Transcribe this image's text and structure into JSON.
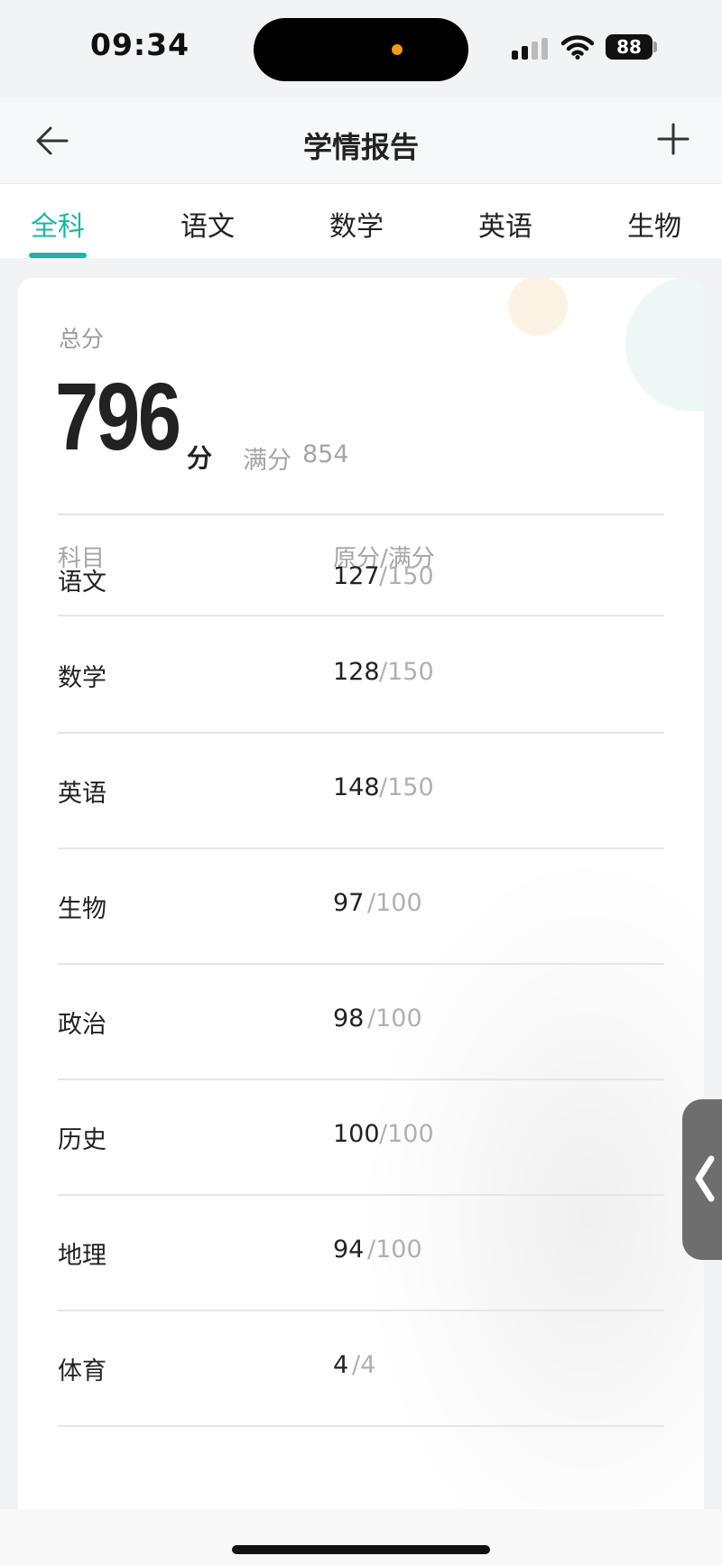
{
  "status_bar": {
    "time": "09:34",
    "battery": "88"
  },
  "nav": {
    "title": "学情报告"
  },
  "tabs": [
    {
      "label": "全科",
      "active": true
    },
    {
      "label": "语文",
      "active": false
    },
    {
      "label": "数学",
      "active": false
    },
    {
      "label": "英语",
      "active": false
    },
    {
      "label": "生物",
      "active": false
    }
  ],
  "summary": {
    "total_label": "总分",
    "total_value": "796",
    "total_unit": "分",
    "full_score_label": "满分",
    "full_score_value": "854"
  },
  "table": {
    "header_subject": "科目",
    "header_score": "原分/满分",
    "rows": [
      {
        "subject": "语文",
        "score": "127",
        "full": "/150"
      },
      {
        "subject": "数学",
        "score": "128",
        "full": "/150"
      },
      {
        "subject": "英语",
        "score": "148",
        "full": "/150"
      },
      {
        "subject": "生物",
        "score": "97",
        "full": "/100"
      },
      {
        "subject": "政治",
        "score": "98",
        "full": "/100"
      },
      {
        "subject": "历史",
        "score": "100",
        "full": "/100"
      },
      {
        "subject": "地理",
        "score": "94",
        "full": "/100"
      },
      {
        "subject": "体育",
        "score": "4",
        "full": "/4"
      }
    ]
  },
  "colors": {
    "accent": "#1bb4a3",
    "text": "#222222",
    "muted": "#a5a5a5",
    "background": "#f2f3f5"
  },
  "icons": {
    "back": "arrow-left-icon",
    "add": "plus-icon",
    "signal": "cellular-signal-icon",
    "wifi": "wifi-icon",
    "battery": "battery-icon",
    "side_handle": "chevron-left-icon"
  }
}
